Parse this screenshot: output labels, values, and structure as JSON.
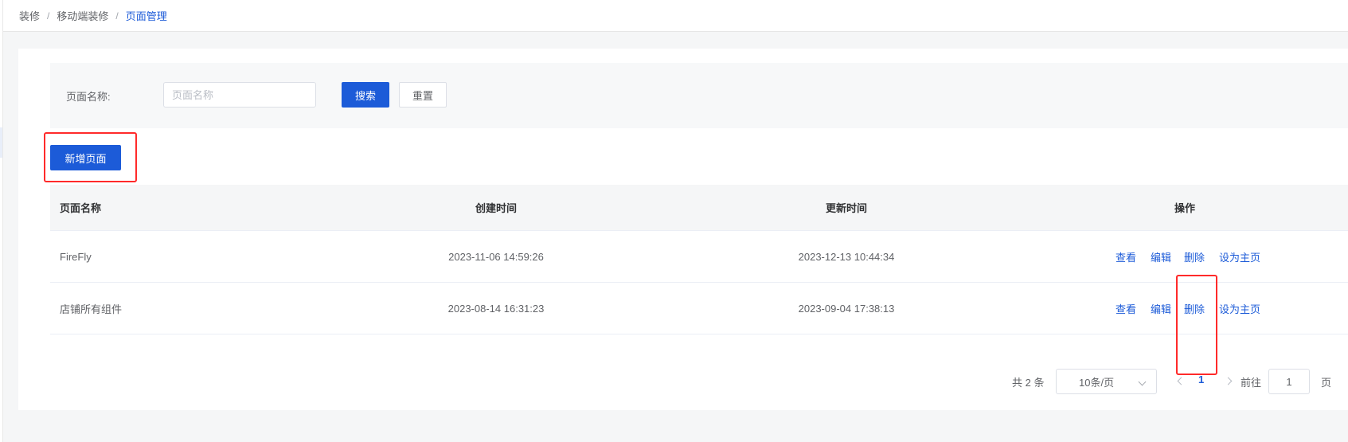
{
  "breadcrumb": {
    "items": [
      "装修",
      "移动端装修",
      "页面管理"
    ],
    "separator": "/"
  },
  "search": {
    "label": "页面名称:",
    "placeholder": "页面名称",
    "value": "",
    "search_label": "搜索",
    "reset_label": "重置"
  },
  "actions": {
    "new_page_label": "新增页面"
  },
  "table": {
    "headers": {
      "name": "页面名称",
      "created": "创建时间",
      "updated": "更新时间",
      "ops": "操作"
    },
    "rows": [
      {
        "name": "FireFly",
        "created": "2023-11-06 14:59:26",
        "updated": "2023-12-13 10:44:34"
      },
      {
        "name": "店铺所有组件",
        "created": "2023-08-14 16:31:23",
        "updated": "2023-09-04 17:38:13"
      }
    ],
    "ops_labels": {
      "view": "查看",
      "edit": "编辑",
      "delete": "删除",
      "set_home": "设为主页"
    }
  },
  "pagination": {
    "total_text": "共 2 条",
    "page_size": "10条/页",
    "current_page": "1",
    "goto_label": "前往",
    "goto_value": "1",
    "goto_suffix": "页"
  },
  "colors": {
    "primary": "#1c5bd8",
    "highlight": "#ff2a2a",
    "background": "#f5f6f7"
  }
}
